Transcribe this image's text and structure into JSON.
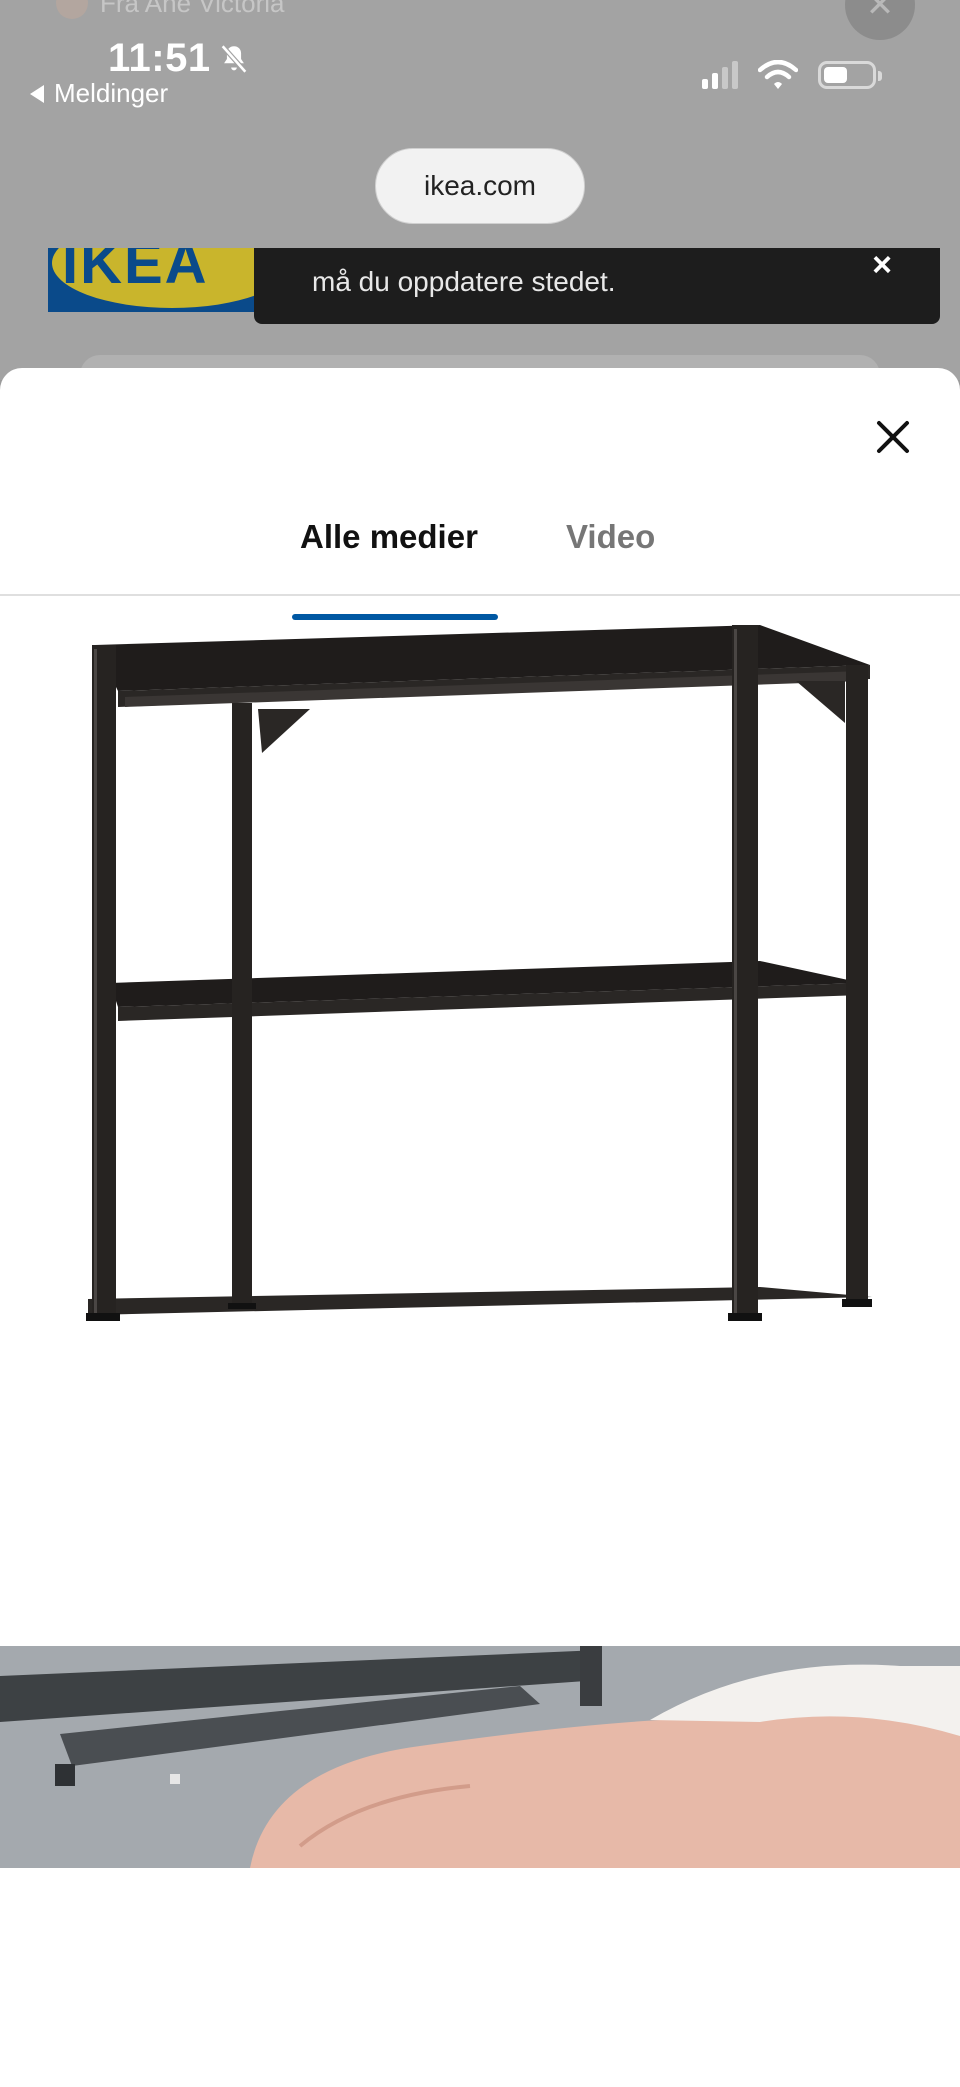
{
  "status_bar": {
    "time": "11:51",
    "back_label": "Meldinger"
  },
  "background": {
    "notification_text": "Fra Ane Victoria",
    "url": "ikea.com",
    "logo_text": "IKEA",
    "toast_message": "må du oppdatere stedet.",
    "toast_close": "×"
  },
  "sheet": {
    "tabs": [
      {
        "label": "Alle medier",
        "active": true
      },
      {
        "label": "Video",
        "active": false
      }
    ],
    "accent_color": "#0058a3",
    "media": [
      {
        "kind": "image",
        "subject": "shelf-frame-icon"
      },
      {
        "kind": "video",
        "subject": "video-thumbnail"
      }
    ]
  }
}
